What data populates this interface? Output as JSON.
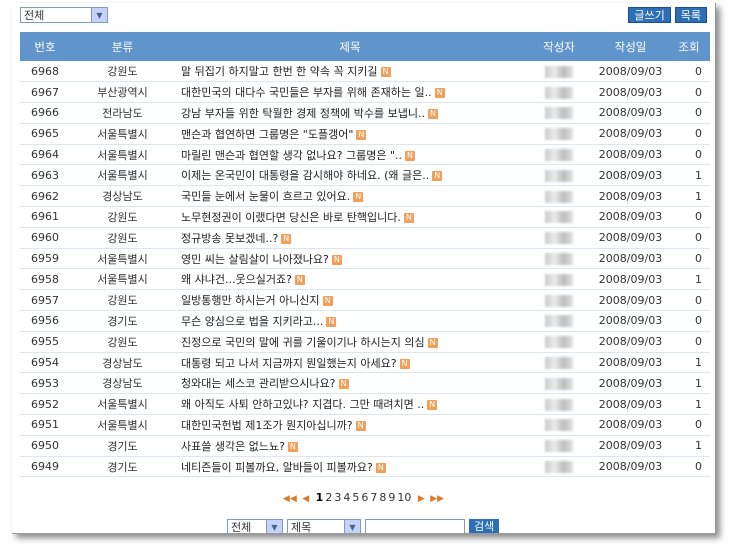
{
  "top": {
    "filter_value": "전체",
    "write_label": "글쓰기",
    "list_label": "목록"
  },
  "table": {
    "headers": [
      "번호",
      "분류",
      "제목",
      "작성자",
      "작성일",
      "조회"
    ],
    "rows": [
      {
        "num": "6968",
        "cat": "강원도",
        "title": "말 뒤집기 하지말고 한번 한 약속 꼭 지키길",
        "date": "2008/09/03",
        "views": "0"
      },
      {
        "num": "6967",
        "cat": "부산광역시",
        "title": "대한민국의 대다수 국민들은 부자를 위해 존재하는 일..",
        "date": "2008/09/03",
        "views": "0"
      },
      {
        "num": "6966",
        "cat": "전라남도",
        "title": "강남 부자들 위한 탁월한 경제 정책에 박수를 보냅니..",
        "date": "2008/09/03",
        "views": "0"
      },
      {
        "num": "6965",
        "cat": "서울특별시",
        "title": "맨슨과 협연하면 그룹명은 \"도플갱어\"",
        "date": "2008/09/03",
        "views": "0"
      },
      {
        "num": "6964",
        "cat": "서울특별시",
        "title": "마릴린 맨슨과 협연할 생각 없나요? 그룹명은 \"..",
        "date": "2008/09/03",
        "views": "0"
      },
      {
        "num": "6963",
        "cat": "서울특별시",
        "title": "이제는 온국민이 대통령을 감시해야 하네요. (왜 글은..",
        "date": "2008/09/03",
        "views": "1"
      },
      {
        "num": "6962",
        "cat": "경상남도",
        "title": "국민들 눈에서 눈물이 흐르고 있어요.",
        "date": "2008/09/03",
        "views": "1"
      },
      {
        "num": "6961",
        "cat": "강원도",
        "title": "노무현정권이 이랬다면 당신은 바로 탄핵입니다.",
        "date": "2008/09/03",
        "views": "0"
      },
      {
        "num": "6960",
        "cat": "강원도",
        "title": "정규방송 못보겠네..?",
        "date": "2008/09/03",
        "views": "0"
      },
      {
        "num": "6959",
        "cat": "서울특별시",
        "title": "영민 씨는 살림살이 나아졌나요?",
        "date": "2008/09/03",
        "views": "0"
      },
      {
        "num": "6958",
        "cat": "서울특별시",
        "title": "왜 샤냐건...웃으실거죠?",
        "date": "2008/09/03",
        "views": "1"
      },
      {
        "num": "6957",
        "cat": "강원도",
        "title": "일방통행만 하시는거 아니신지",
        "date": "2008/09/03",
        "views": "0"
      },
      {
        "num": "6956",
        "cat": "경기도",
        "title": "무슨 양심으로 법을 지키라고...",
        "date": "2008/09/03",
        "views": "0"
      },
      {
        "num": "6955",
        "cat": "강원도",
        "title": "진정으로 국민의 말에 귀를 기울이기나 하시는지 의심",
        "date": "2008/09/03",
        "views": "0"
      },
      {
        "num": "6954",
        "cat": "경상남도",
        "title": "대통령 되고 나서 지금까지 뭔일했는지 아세요?",
        "date": "2008/09/03",
        "views": "1"
      },
      {
        "num": "6953",
        "cat": "경상남도",
        "title": "청와대는 세스코 관리받으시나요?",
        "date": "2008/09/03",
        "views": "1"
      },
      {
        "num": "6952",
        "cat": "서울특별시",
        "title": "왜 아직도 사퇴 안하고있냐? 지겹다. 그만 때려치면 ..",
        "date": "2008/09/03",
        "views": "1"
      },
      {
        "num": "6951",
        "cat": "서울특별시",
        "title": "대한민국헌법 제1조가 뭔지아십니까?",
        "date": "2008/09/03",
        "views": "0"
      },
      {
        "num": "6950",
        "cat": "경기도",
        "title": "사표쓸 생각은 없느뇨?",
        "date": "2008/09/03",
        "views": "1"
      },
      {
        "num": "6949",
        "cat": "경기도",
        "title": "네티즌들이 피볼까요, 알바들이 피볼까요?",
        "date": "2008/09/03",
        "views": "0"
      }
    ]
  },
  "pager": {
    "pages": [
      "1",
      "2",
      "3",
      "4",
      "5",
      "6",
      "7",
      "8",
      "9",
      "10"
    ],
    "current": "1"
  },
  "search": {
    "scope_value": "전체",
    "field_value": "제목",
    "button_label": "검색"
  },
  "colors": {
    "header_bg": "#5f95cb",
    "button_bg": "#2c6fb7",
    "new_icon": "#f0a05a"
  }
}
